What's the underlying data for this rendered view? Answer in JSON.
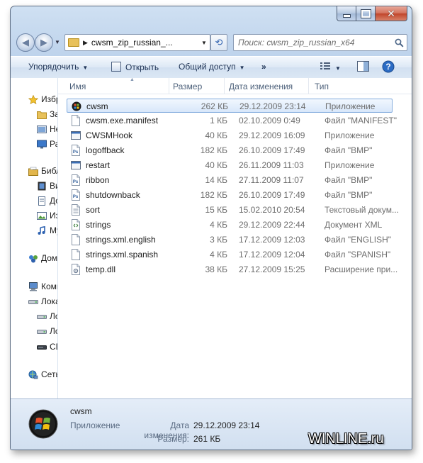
{
  "window": {
    "caption": {
      "minimize": "",
      "maximize": "",
      "close": "✕"
    }
  },
  "navigation": {
    "address_path": "cwsm_zip_russian_...",
    "search_placeholder": "Поиск: cwsm_zip_russian_x64"
  },
  "toolbar": {
    "organize_label": "Упорядочить",
    "open_label": "Открыть",
    "share_label": "Общий доступ",
    "more_label": "»"
  },
  "sidebar": {
    "items": [
      {
        "label": "Избранное",
        "icon": "star-icon"
      },
      {
        "label": "Загрузки",
        "icon": "folder-icon"
      },
      {
        "label": "Недавние места",
        "icon": "recent-icon"
      },
      {
        "label": "Рабочий стол",
        "icon": "desktop-icon"
      },
      {
        "label": "Библиотеки",
        "icon": "library-icon"
      },
      {
        "label": "Видео",
        "icon": "video-icon"
      },
      {
        "label": "Документы",
        "icon": "documents-icon"
      },
      {
        "label": "Изображения",
        "icon": "pictures-icon"
      },
      {
        "label": "Музыка",
        "icon": "music-icon"
      },
      {
        "label": "Домашняя группа",
        "icon": "homegroup-icon"
      },
      {
        "label": "Компьютер",
        "icon": "computer-icon"
      },
      {
        "label": "Локальный диск",
        "icon": "drive-icon"
      },
      {
        "label": "Локальный диск",
        "icon": "drive-icon"
      },
      {
        "label": "Локальный диск",
        "icon": "drive-icon"
      },
      {
        "label": "CD-дисковод",
        "icon": "cd-drive-icon"
      },
      {
        "label": "Сеть",
        "icon": "network-icon"
      }
    ]
  },
  "columns": {
    "name": "Имя",
    "size": "Размер",
    "date": "Дата изменения",
    "type": "Тип"
  },
  "files": [
    {
      "name": "cwsm",
      "size": "262 КБ",
      "date": "29.12.2009 23:14",
      "type": "Приложение",
      "icon": "windows-app-icon",
      "selected": true
    },
    {
      "name": "cwsm.exe.manifest",
      "size": "1 КБ",
      "date": "02.10.2009 0:49",
      "type": "Файл \"MANIFEST\"",
      "icon": "blank-file-icon"
    },
    {
      "name": "CWSMHook",
      "size": "40 КБ",
      "date": "29.12.2009 16:09",
      "type": "Приложение",
      "icon": "app-file-icon"
    },
    {
      "name": "logoffback",
      "size": "182 КБ",
      "date": "26.10.2009 17:49",
      "type": "Файл \"BMP\"",
      "icon": "ps-file-icon"
    },
    {
      "name": "restart",
      "size": "40 КБ",
      "date": "26.11.2009 11:03",
      "type": "Приложение",
      "icon": "app-file-icon"
    },
    {
      "name": "ribbon",
      "size": "14 КБ",
      "date": "27.11.2009 11:07",
      "type": "Файл \"BMP\"",
      "icon": "ps-file-icon"
    },
    {
      "name": "shutdownback",
      "size": "182 КБ",
      "date": "26.10.2009 17:49",
      "type": "Файл \"BMP\"",
      "icon": "ps-file-icon"
    },
    {
      "name": "sort",
      "size": "15 КБ",
      "date": "15.02.2010 20:54",
      "type": "Текстовый докум...",
      "icon": "text-file-icon"
    },
    {
      "name": "strings",
      "size": "4 КБ",
      "date": "29.12.2009 22:44",
      "type": "Документ XML",
      "icon": "xml-file-icon"
    },
    {
      "name": "strings.xml.english",
      "size": "3 КБ",
      "date": "17.12.2009 12:03",
      "type": "Файл \"ENGLISH\"",
      "icon": "blank-file-icon"
    },
    {
      "name": "strings.xml.spanish",
      "size": "4 КБ",
      "date": "17.12.2009 12:04",
      "type": "Файл \"SPANISH\"",
      "icon": "blank-file-icon"
    },
    {
      "name": "temp.dll",
      "size": "38 КБ",
      "date": "27.12.2009 15:25",
      "type": "Расширение при...",
      "icon": "dll-file-icon"
    }
  ],
  "details": {
    "name": "cwsm",
    "type": "Приложение",
    "modified_label": "Дата изменения:",
    "modified_value": "29.12.2009 23:14",
    "size_label": "Размер:",
    "size_value": "261 КБ"
  },
  "watermark": "WINLINE.ru",
  "colors": {
    "accent": "#1e3355",
    "selection_border": "#84acdd",
    "close_button": "#c0442a"
  }
}
